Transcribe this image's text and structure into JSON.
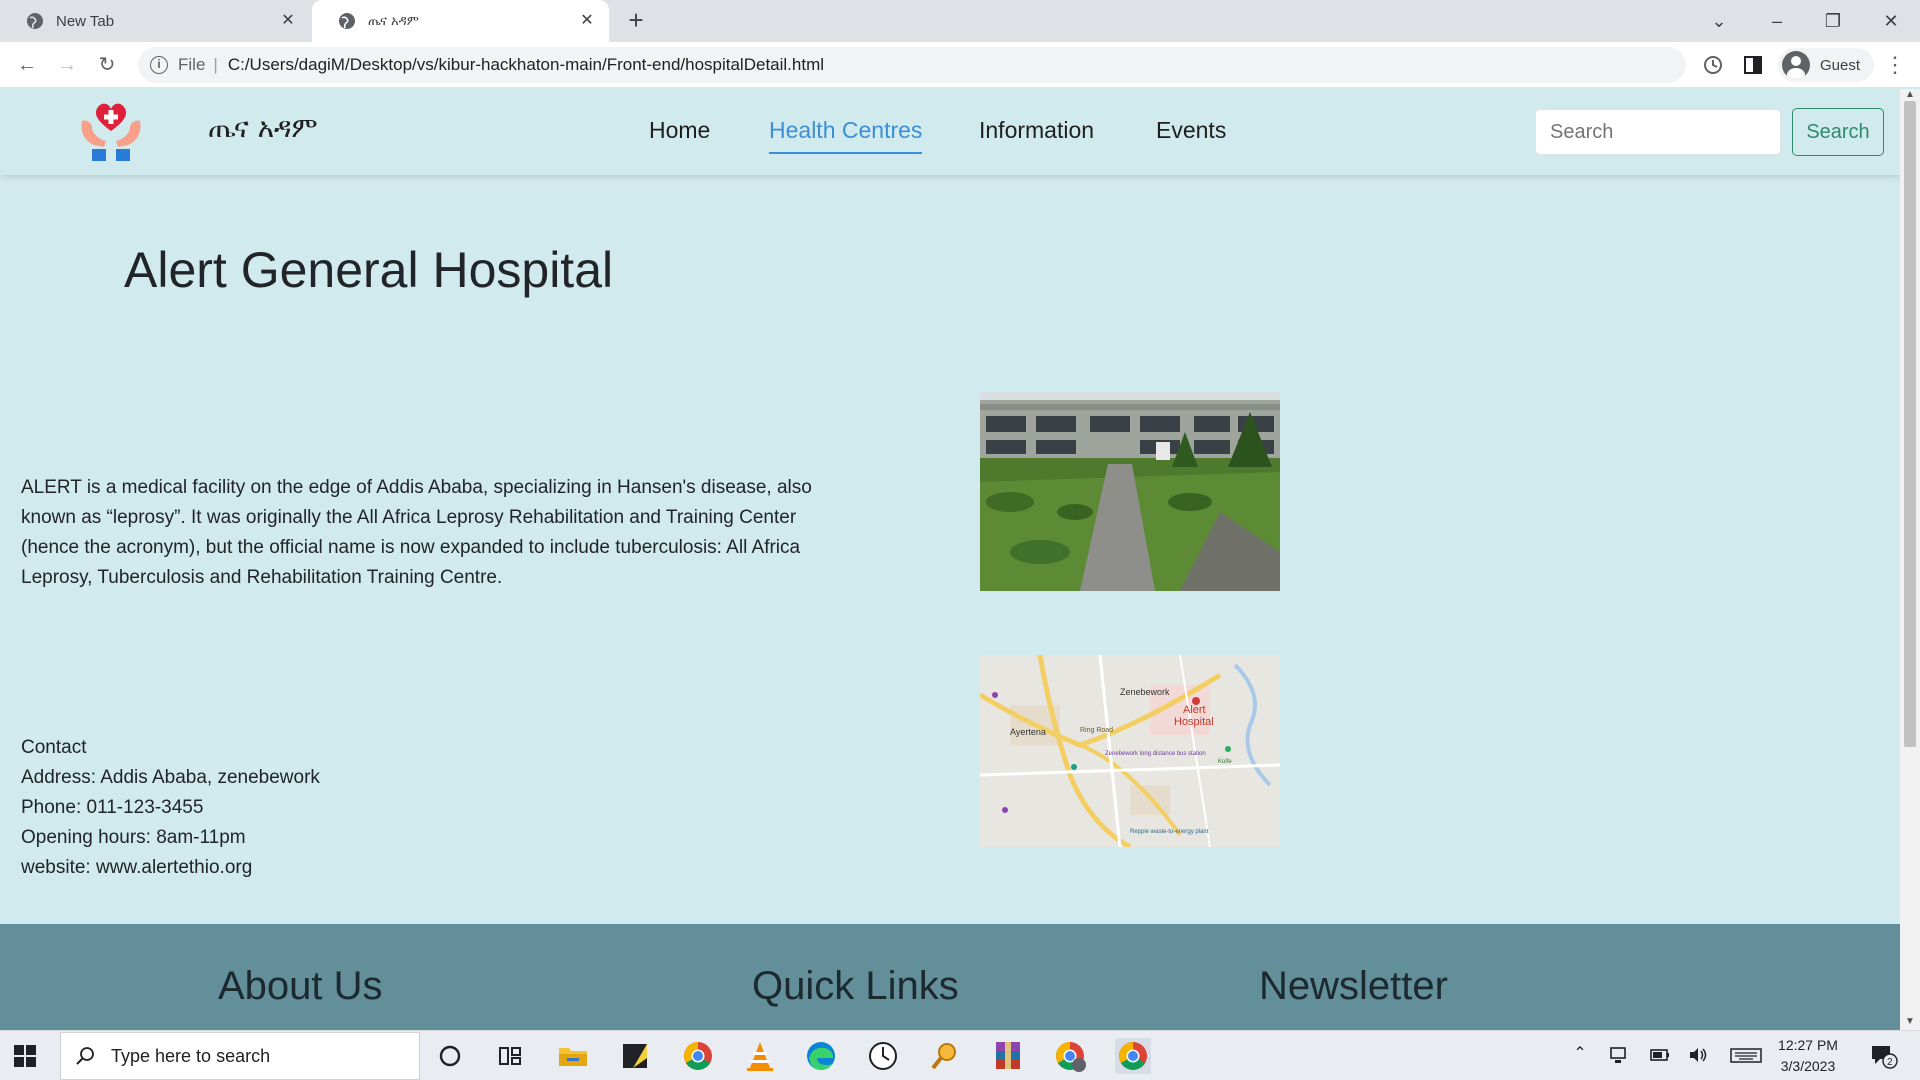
{
  "browser": {
    "tabs": [
      {
        "title": "New Tab",
        "active": false
      },
      {
        "title": "ጤና አዳም",
        "active": true
      }
    ],
    "address": {
      "scheme": "File",
      "url": "C:/Users/dagiM/Desktop/vs/kibur-hackhaton-main/Front-end/hospitalDetail.html"
    },
    "profile_label": "Guest"
  },
  "site": {
    "brand": "ጤና አዳም",
    "nav": [
      {
        "label": "Home",
        "active": false
      },
      {
        "label": "Health Centres",
        "active": true
      },
      {
        "label": "Information",
        "active": false
      },
      {
        "label": "Events",
        "active": false
      }
    ],
    "search": {
      "placeholder": "Search",
      "button_label": "Search"
    },
    "accent_color": "#3a8fd6",
    "button_color": "#2e8a6e",
    "background_color": "#d1eaee",
    "footer_color": "#638f9a"
  },
  "hospital": {
    "name": "Alert General Hospital",
    "description": "ALERT is a medical facility on the edge of Addis Ababa, specializing in Hansen's disease, also known as “leprosy”. It was originally the All Africa Leprosy Rehabilitation and Training Center (hence the acronym), but the official name is now expanded to include tuberculosis: All Africa Leprosy, Tuberculosis and Rehabilitation Training Centre.",
    "contact": {
      "heading": "Contact",
      "address": "Address: Addis Ababa, zenebework",
      "phone": "Phone: 011-123-3455",
      "hours": "Opening hours: 8am-11pm",
      "website": "website: www.alertethio.org"
    },
    "map_labels": {
      "place": "Alert",
      "place2": "Hospital",
      "area1": "Zenebework",
      "area2": "Ayertena",
      "road": "Ring Road",
      "poi1": "Zenebework long distance bus station",
      "poi2": "Kolfe",
      "poi3": "Reppie waste-to-energy plant"
    }
  },
  "footer": {
    "col1": "About Us",
    "col2": "Quick Links",
    "col3": "Newsletter"
  },
  "taskbar": {
    "search_placeholder": "Type here to search",
    "time": "12:27 PM",
    "date": "3/3/2023",
    "notifications": "2"
  }
}
